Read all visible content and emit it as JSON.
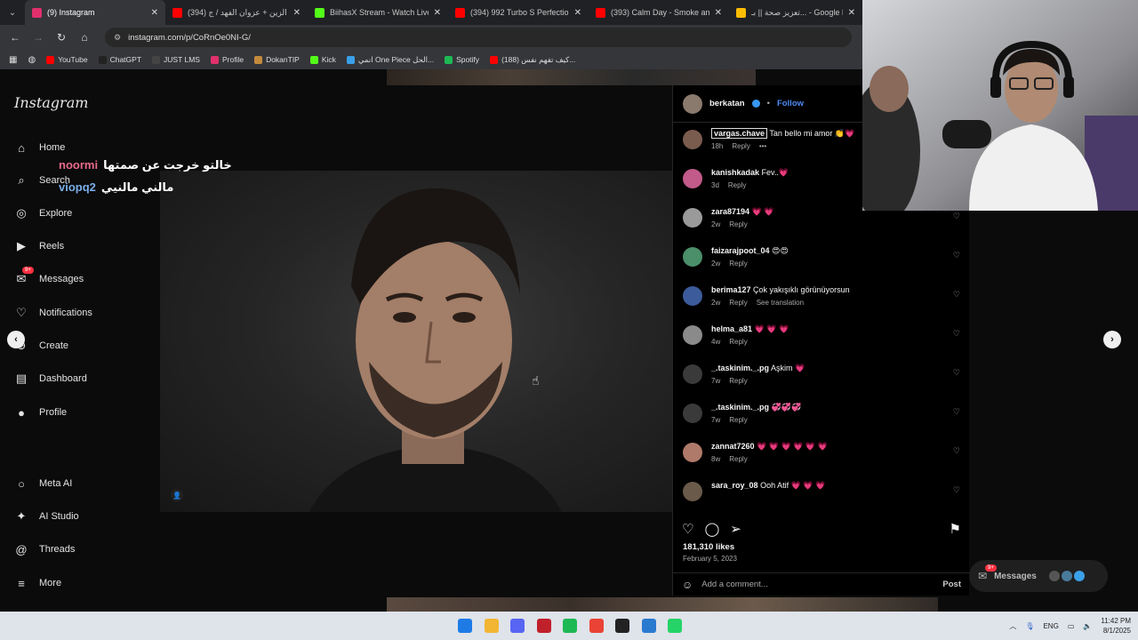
{
  "browser": {
    "tabs": [
      {
        "title": "(9) Instagram",
        "color": "#e1306c",
        "active": true
      },
      {
        "title": "(394) نور الزين + عزوان الفهد / ج",
        "color": "#ff0000",
        "active": false
      },
      {
        "title": "BiihasX Stream - Watch Live on",
        "color": "#53fc18",
        "active": false
      },
      {
        "title": "(394) 992 Turbo S Perfection [4",
        "color": "#ff0000",
        "active": false
      },
      {
        "title": "(393) Calm Day - Smoke and C",
        "color": "#ff0000",
        "active": false
      },
      {
        "title": "تعزيز صحة || بـ... - Google Drive",
        "color": "#fbbc04",
        "active": false
      }
    ],
    "url": "instagram.com/p/CoRnOe0NI-G/",
    "bookmarks": [
      {
        "label": "YouTube",
        "color": "#ff0000"
      },
      {
        "label": "ChatGPT",
        "color": "#222222"
      },
      {
        "label": "JUST LMS",
        "color": "#444444"
      },
      {
        "label": "Profile",
        "color": "#e1306c"
      },
      {
        "label": "DokanTIP",
        "color": "#c48a3c"
      },
      {
        "label": "Kick",
        "color": "#53fc18"
      },
      {
        "label": "انمي One Piece الحل...",
        "color": "#3aa0e8"
      },
      {
        "label": "Spotify",
        "color": "#1db954"
      },
      {
        "label": "(188) كيف تفهم نفس...",
        "color": "#ff0000"
      }
    ]
  },
  "instagram": {
    "logo": "Instagram",
    "nav": [
      {
        "name": "home",
        "label": "Home",
        "icon": "⌂"
      },
      {
        "name": "search",
        "label": "Search",
        "icon": "⌕"
      },
      {
        "name": "explore",
        "label": "Explore",
        "icon": "◎"
      },
      {
        "name": "reels",
        "label": "Reels",
        "icon": "▶"
      },
      {
        "name": "messages",
        "label": "Messages",
        "icon": "✉"
      },
      {
        "name": "notifications",
        "label": "Notifications",
        "icon": "♡"
      },
      {
        "name": "create",
        "label": "Create",
        "icon": "⊕"
      },
      {
        "name": "dashboard",
        "label": "Dashboard",
        "icon": "▤"
      },
      {
        "name": "profile",
        "label": "Profile",
        "icon": "●"
      }
    ],
    "nav_bottom": [
      {
        "name": "meta-ai",
        "label": "Meta AI",
        "icon": "○"
      },
      {
        "name": "ai-studio",
        "label": "AI Studio",
        "icon": "✦"
      },
      {
        "name": "threads",
        "label": "Threads",
        "icon": "@"
      },
      {
        "name": "more",
        "label": "More",
        "icon": "≡"
      }
    ],
    "messages_badge": "9+",
    "post": {
      "author": "berkatan",
      "follow_label": "Follow",
      "likes": "181,310 likes",
      "date": "February 5, 2023",
      "add_comment_placeholder": "Add a comment...",
      "post_label": "Post"
    },
    "comments": [
      {
        "user": "vargas.chave",
        "text": "Tan bello mi amor 👏💗",
        "age": "18h",
        "reply": "Reply",
        "extra": "•••",
        "avatar": "#7a5c4e"
      },
      {
        "user": "kanishkadak",
        "text": "Fev..💗",
        "age": "3d",
        "reply": "Reply",
        "extra": "",
        "avatar": "#c25a8a"
      },
      {
        "user": "zara87194",
        "text": "💗 💗",
        "age": "2w",
        "reply": "Reply",
        "extra": "",
        "avatar": "#9a9a9a"
      },
      {
        "user": "faizarajpoot_04",
        "text": "😍😍",
        "age": "2w",
        "reply": "Reply",
        "extra": "",
        "avatar": "#4a8f6a"
      },
      {
        "user": "berima127",
        "text": "Çok yakışıklı görünüyorsun",
        "age": "2w",
        "reply": "Reply",
        "extra": "See translation",
        "avatar": "#3b5b9a"
      },
      {
        "user": "helma_a81",
        "text": "💗 💗 💗",
        "age": "4w",
        "reply": "Reply",
        "extra": "",
        "avatar": "#8a8a8a"
      },
      {
        "user": "_.taskinim._.pg",
        "text": "Aşkim 💗",
        "age": "7w",
        "reply": "Reply",
        "extra": "",
        "avatar": "#3a3a3a"
      },
      {
        "user": "_.taskinim._.pg",
        "text": "💞💞💞",
        "age": "7w",
        "reply": "Reply",
        "extra": "",
        "avatar": "#3a3a3a"
      },
      {
        "user": "zannat7260",
        "text": "💗 💗 💗 💗 💗 💗",
        "age": "8w",
        "reply": "Reply",
        "extra": "",
        "avatar": "#b07a6a"
      },
      {
        "user": "sara_roy_08",
        "text": "Ooh Atif 💗 💗 💗",
        "age": "",
        "reply": "",
        "extra": "",
        "avatar": "#6a5a4a"
      }
    ],
    "floating_messages": {
      "label": "Messages",
      "badge": "9+"
    }
  },
  "stream_chat": [
    {
      "user": "noormi",
      "text": "خالتو خرجت عن صمتها",
      "color": "#e86a8a"
    },
    {
      "user": "viopq2",
      "text": "مالني مالنيي",
      "color": "#7aaee8"
    }
  ],
  "taskbar": {
    "lang": "ENG",
    "time": "11:42 PM",
    "date": "8/1/2025"
  }
}
